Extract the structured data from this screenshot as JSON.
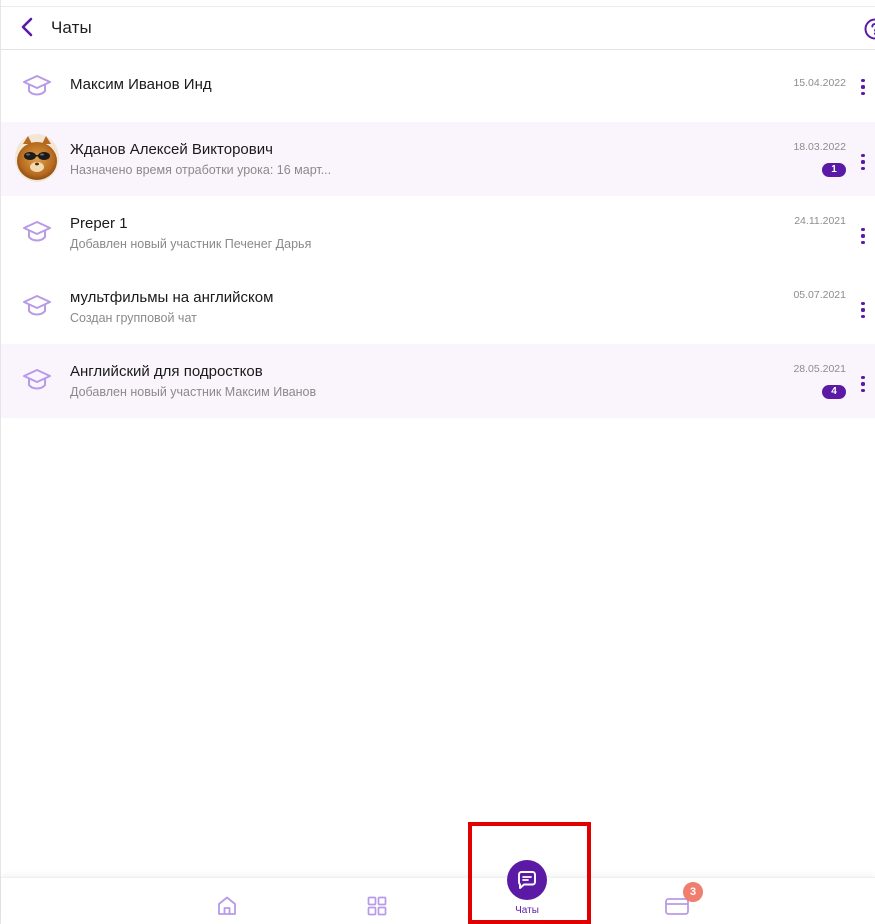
{
  "header": {
    "title": "Чаты",
    "back_icon": "chevron-left-icon",
    "help_icon": "question-circle-icon"
  },
  "chats": [
    {
      "name": "Максим Иванов Инд",
      "subtitle": "",
      "date": "15.04.2022",
      "unread": "",
      "avatar": "graduation-cap-icon"
    },
    {
      "name": "Жданов Алексей Викторович",
      "subtitle": "Назначено время отработки урока: 16 март...",
      "date": "18.03.2022",
      "unread": "1",
      "avatar": "user-photo"
    },
    {
      "name": "Preper 1",
      "subtitle": "Добавлен новый участник Печенег Дарья",
      "date": "24.11.2021",
      "unread": "",
      "avatar": "graduation-cap-icon"
    },
    {
      "name": "мультфильмы на английском",
      "subtitle": "Создан групповой чат",
      "date": "05.07.2021",
      "unread": "",
      "avatar": "graduation-cap-icon"
    },
    {
      "name": "Английский для подростков",
      "subtitle": "Добавлен новый участник Максим Иванов",
      "date": "28.05.2021",
      "unread": "4",
      "avatar": "graduation-cap-icon"
    }
  ],
  "bottom_nav": {
    "chats_label": "Чаты",
    "payments_badge": "3",
    "items": [
      "home-icon",
      "grid-icon",
      "chat-icon",
      "card-icon"
    ]
  },
  "colors": {
    "accent": "#5b1aa6",
    "icon_light": "#b89ae8",
    "unread_row_bg": "#faf5fd",
    "badge_red": "#f07e6e",
    "highlight": "#e00000"
  }
}
